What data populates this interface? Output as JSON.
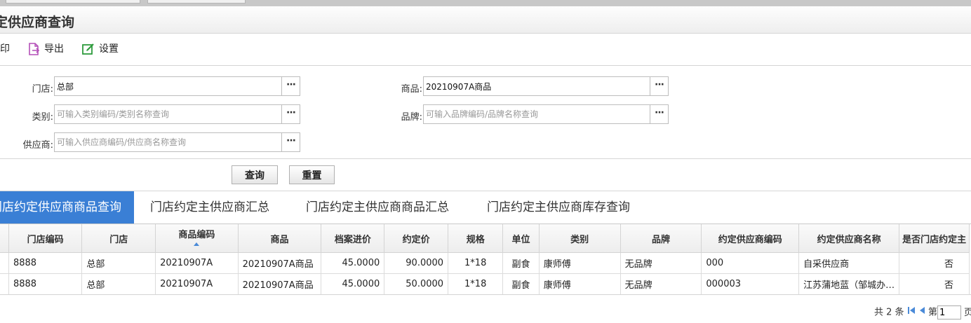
{
  "page": {
    "title": "定供应商查询"
  },
  "toolbar": {
    "print_label": "打印",
    "export_label": "导出",
    "settings_label": "设置"
  },
  "filters": {
    "store_label": "门店:",
    "store_value": "总部",
    "product_label": "商品:",
    "product_value": "20210907A商品",
    "category_label": "类别:",
    "category_placeholder": "可输入类别编码/类别名称查询",
    "brand_label": "品牌:",
    "brand_placeholder": "可输入品牌编码/品牌名称查询",
    "supplier_label": "供应商:",
    "supplier_placeholder": "可输入供应商编码/供应商名称查询",
    "lookup_label": "···"
  },
  "actions": {
    "query_label": "查询",
    "reset_label": "重置"
  },
  "tabs": [
    {
      "label": "门店约定供应商商品查询",
      "active": true
    },
    {
      "label": "门店约定主供应商汇总",
      "active": false
    },
    {
      "label": "门店约定主供应商商品汇总",
      "active": false
    },
    {
      "label": "门店约定主供应商库存查询",
      "active": false
    }
  ],
  "table": {
    "columns": [
      "门店编码",
      "门店",
      "商品编码",
      "商品",
      "档案进价",
      "约定价",
      "规格",
      "单位",
      "类别",
      "品牌",
      "约定供应商编码",
      "约定供应商名称",
      "是否门店约定主"
    ],
    "rows": [
      [
        "8888",
        "总部",
        "20210907A",
        "20210907A商品",
        "45.0000",
        "90.0000",
        "1*18",
        "副食",
        "康师傅",
        "无品牌",
        "000",
        "自采供应商",
        "否"
      ],
      [
        "8888",
        "总部",
        "20210907A",
        "20210907A商品",
        "45.0000",
        "50.0000",
        "1*18",
        "副食",
        "康师傅",
        "无品牌",
        "000003",
        "江苏蒲地蓝（邹城办…",
        "否"
      ]
    ]
  },
  "pager": {
    "total_label": "共 2 条",
    "page_prefix": "第",
    "page_value": "1",
    "page_suffix": "页"
  },
  "colors": {
    "accent": "#3a7fd5",
    "export_icon": "#b44fb8",
    "settings_icon": "#2e9b3c"
  }
}
